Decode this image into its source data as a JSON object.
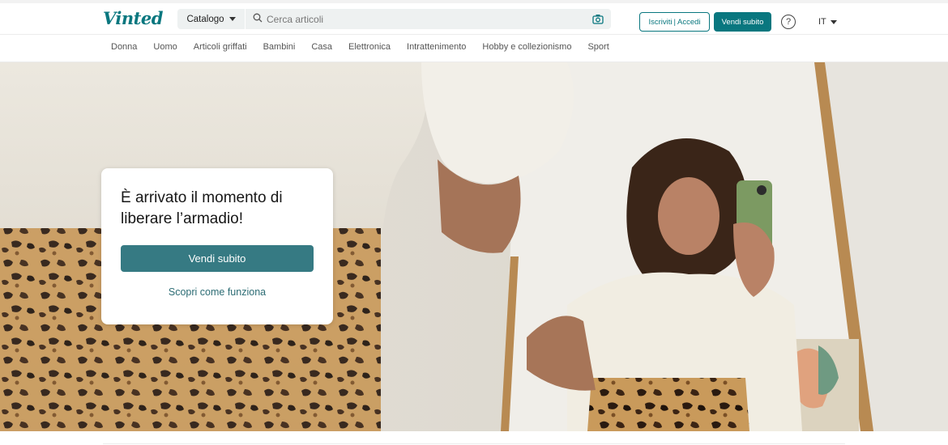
{
  "header": {
    "logo": "Vinted",
    "catalog_label": "Catalogo",
    "search_placeholder": "Cerca articoli",
    "signup_label": "Iscriviti",
    "login_label": "Accedi",
    "sell_label": "Vendi subito",
    "help_label": "?",
    "language": "IT"
  },
  "nav": {
    "items": [
      "Donna",
      "Uomo",
      "Articoli griffati",
      "Bambini",
      "Casa",
      "Elettronica",
      "Intrattenimento",
      "Hobby e collezionismo",
      "Sport"
    ]
  },
  "hero": {
    "headline": "È arrivato il momento di liberare l’armadio!",
    "cta_label": "Vendi subito",
    "link_label": "Scopri come funziona"
  },
  "colors": {
    "brand": "#09777f",
    "cta": "#367a83"
  },
  "icons": [
    "search-icon",
    "camera-icon",
    "help-icon",
    "chevron-down-icon"
  ]
}
